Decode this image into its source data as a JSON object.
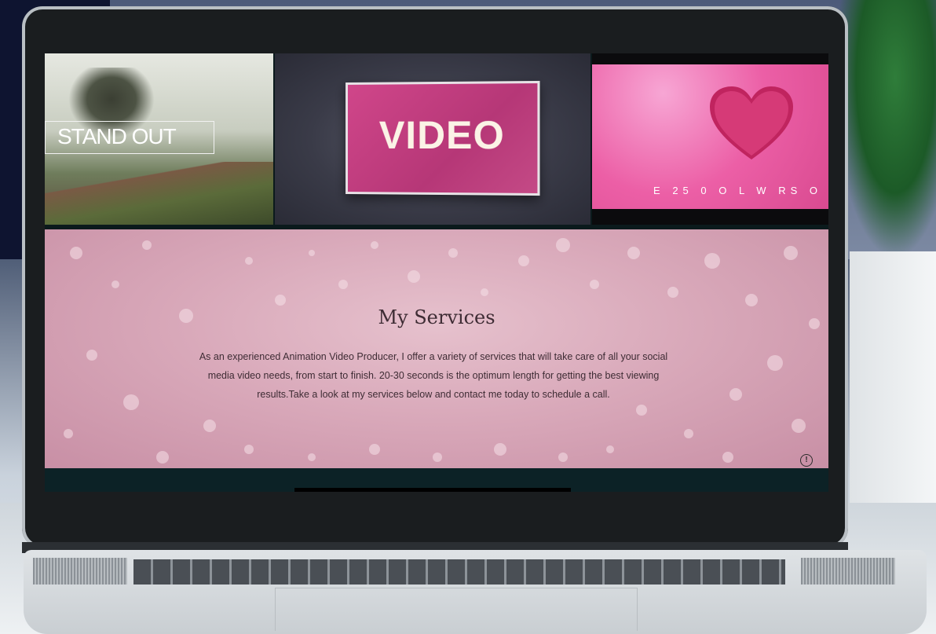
{
  "hero": {
    "tile_1": {
      "label": "STAND OUT"
    },
    "tile_2": {
      "label": "VIDEO"
    },
    "tile_3": {
      "caption": "E 25 0 O L W RS  O"
    }
  },
  "services": {
    "title": "My Services",
    "body": "As an experienced Animation Video Producer, I offer a variety of services that will take care of all your social media video needs, from start to finish. 20-30 seconds is the optimum length for getting the best viewing results.Take a look at my services below and contact me today to schedule a call."
  },
  "info_badge": {
    "glyph": "!"
  },
  "colors": {
    "accent_pink": "#d9488f",
    "services_bg": "#d9a9ba",
    "text_dark": "#3e2c34"
  }
}
